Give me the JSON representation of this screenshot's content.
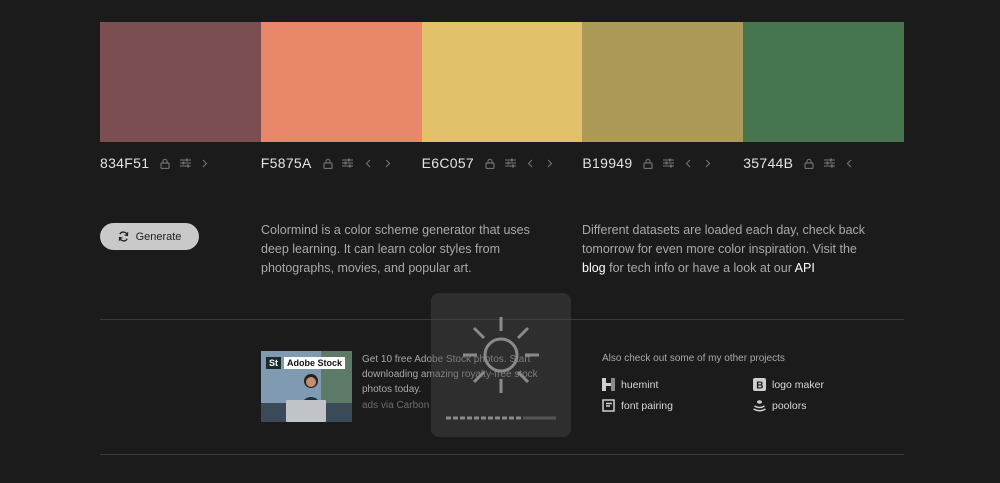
{
  "palette": [
    {
      "hex": "834F51",
      "color": "#7b4f51",
      "controls": [
        "lock-icon",
        "adjust-icon",
        "arrow-right-icon"
      ]
    },
    {
      "hex": "F5875A",
      "color": "#e8876a",
      "controls": [
        "lock-icon",
        "adjust-icon",
        "arrow-left-icon",
        "arrow-right-icon"
      ]
    },
    {
      "hex": "E6C057",
      "color": "#e2c06a",
      "controls": [
        "lock-icon",
        "adjust-icon",
        "arrow-left-icon",
        "arrow-right-icon"
      ]
    },
    {
      "hex": "B19949",
      "color": "#ad9a58",
      "controls": [
        "lock-icon",
        "adjust-icon",
        "arrow-left-icon",
        "arrow-right-icon"
      ]
    },
    {
      "hex": "35744B",
      "color": "#467550",
      "controls": [
        "lock-icon",
        "adjust-icon",
        "arrow-left-icon"
      ]
    }
  ],
  "generate": {
    "label": "Generate",
    "icon": "refresh-icon"
  },
  "description_left": {
    "text": "Colormind is a color scheme generator that uses deep learning. It can learn color styles from photographs, movies, and popular art."
  },
  "description_right": {
    "part1": "Different datasets are loaded each day, check back tomorrow for even more color inspiration. Visit the ",
    "blog_link": "blog",
    "part2": " for tech info or have a look at our ",
    "api_link": "API"
  },
  "ad": {
    "brand": "Adobe Stock",
    "brand_badge": "St",
    "text": "Get 10 free Adobe Stock photos. Start downloading amazing royalty-free stock photos today.",
    "via": "ads via Carbon"
  },
  "projects": {
    "title": "Also check out some of my other projects",
    "items": [
      {
        "label": "huemint",
        "icon": "huemint-icon"
      },
      {
        "label": "logo maker",
        "icon": "logo-maker-icon"
      },
      {
        "label": "font pairing",
        "icon": "font-pairing-icon"
      },
      {
        "label": "poolors",
        "icon": "poolors-icon"
      }
    ]
  },
  "colors": {
    "background": "#1b1b1b",
    "button": "#c9c9c9",
    "divider": "#3a3a3a"
  }
}
